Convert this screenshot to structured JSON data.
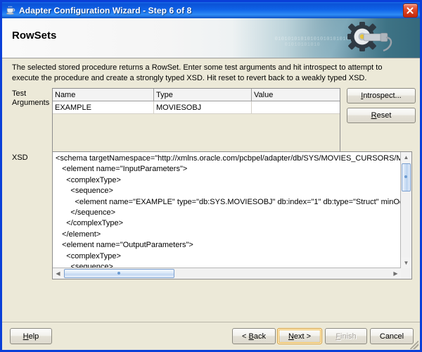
{
  "window": {
    "title": "Adapter Configuration Wizard - Step 6 of 8",
    "app_icon": "java-coffee-cup-icon",
    "close_label": "X",
    "accent_color": "#0a3fd8",
    "titlebar_color": "#0f63e8"
  },
  "banner": {
    "title": "RowSets",
    "art_icon": "gear-wrench-icon",
    "binary_line1": "010101010101010101010101",
    "binary_line2": "01010101010"
  },
  "main": {
    "description": "The selected stored procedure returns a RowSet.  Enter some test arguments and hit introspect to attempt to execute the procedure and create a strongly typed XSD.  Hit reset to revert back to a weakly typed XSD.",
    "test_arguments_label": "Test Arguments",
    "xsd_label": "XSD",
    "table": {
      "columns": [
        "Name",
        "Type",
        "Value"
      ],
      "rows": [
        {
          "name": "EXAMPLE",
          "type": "MOVIESOBJ",
          "value": ""
        }
      ]
    },
    "side_buttons": {
      "introspect": {
        "label": "Introspect...",
        "mnemonic": "I"
      },
      "reset": {
        "label": "Reset",
        "mnemonic": "R"
      }
    },
    "xsd_content": "<schema targetNamespace=\"http://xmlns.oracle.com/pcbpel/adapter/db/SYS/MOVIES_CURSORS/MC\n   <element name=\"InputParameters\">\n     <complexType>\n       <sequence>\n         <element name=\"EXAMPLE\" type=\"db:SYS.MOVIESOBJ\" db:index=\"1\" db:type=\"Struct\" minOc\n       </sequence>\n     </complexType>\n   </element>\n   <element name=\"OutputParameters\">\n     <complexType>\n       <sequence>\n         <element name=\"MOVIES\" type=\"db:RowSet\" db:index=\"2\" db:type=\"RowSet\" minOccurs=\"0"
  },
  "footer": {
    "help": {
      "label": "Help",
      "mnemonic": "H"
    },
    "back": {
      "label": "< Back",
      "mnemonic": "B"
    },
    "next": {
      "label": "Next >",
      "mnemonic": "N",
      "focused": true
    },
    "finish": {
      "label": "Finish",
      "mnemonic": "F",
      "disabled": true
    },
    "cancel": {
      "label": "Cancel"
    }
  }
}
